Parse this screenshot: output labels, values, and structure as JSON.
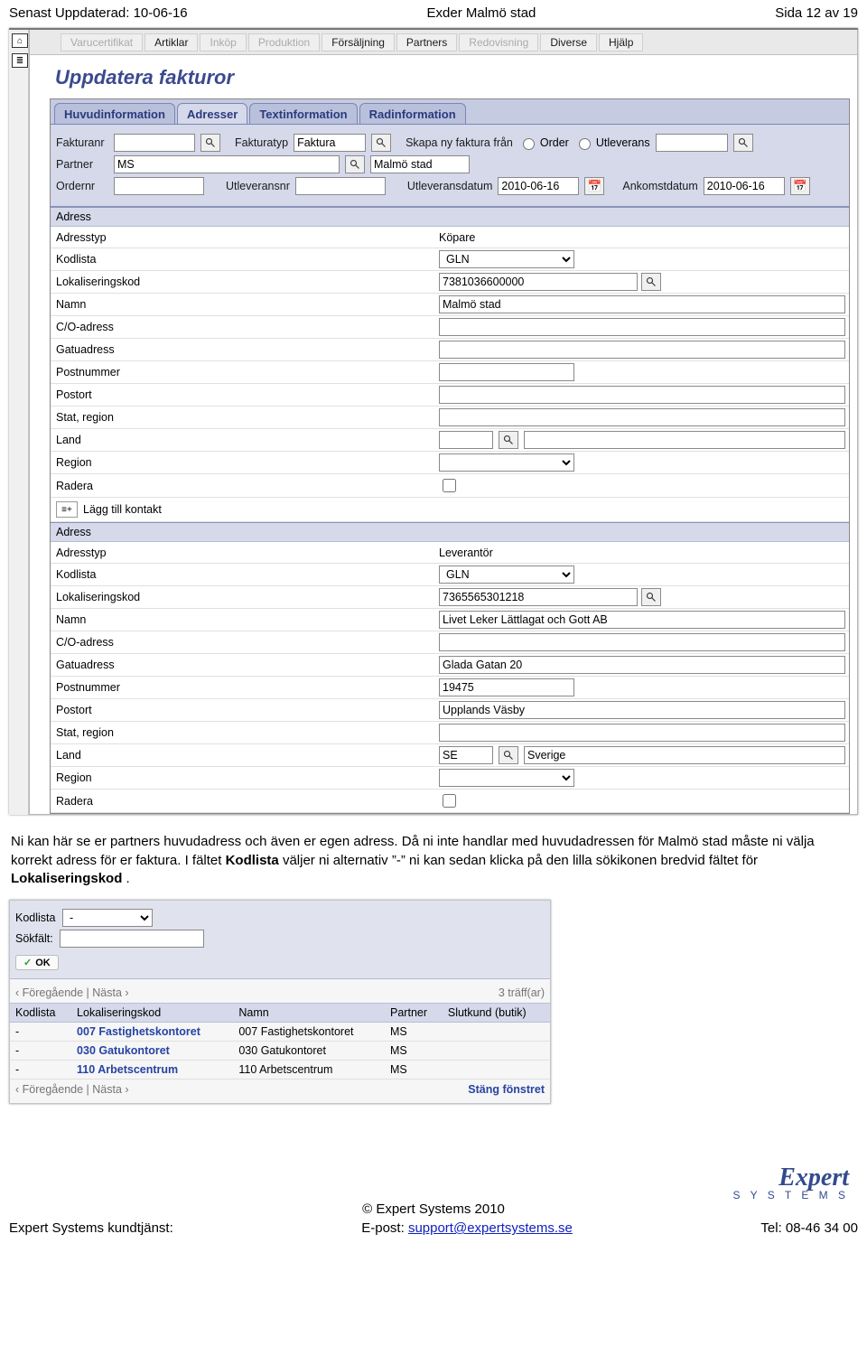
{
  "header": {
    "left": "Senast Uppdaterad: 10-06-16",
    "center": "Exder Malmö stad",
    "right": "Sida 12 av 19"
  },
  "menubar": {
    "items": [
      {
        "label": "Varucertifikat",
        "disabled": true
      },
      {
        "label": "Artiklar",
        "disabled": false
      },
      {
        "label": "Inköp",
        "disabled": true
      },
      {
        "label": "Produktion",
        "disabled": true
      },
      {
        "label": "Försäljning",
        "disabled": false
      },
      {
        "label": "Partners",
        "disabled": false
      },
      {
        "label": "Redovisning",
        "disabled": true
      },
      {
        "label": "Diverse",
        "disabled": false
      },
      {
        "label": "Hjälp",
        "disabled": false
      }
    ]
  },
  "page_title": "Uppdatera fakturor",
  "tabs": {
    "items": [
      {
        "label": "Huvudinformation",
        "active": false
      },
      {
        "label": "Adresser",
        "active": true
      },
      {
        "label": "Textinformation",
        "active": false
      },
      {
        "label": "Radinformation",
        "active": false
      }
    ]
  },
  "top_form": {
    "fakturanr_label": "Fakturanr",
    "fakturanr": "",
    "fakturatyp_label": "Fakturatyp",
    "fakturatyp": "Faktura",
    "skapa_label": "Skapa ny faktura från",
    "order_label": "Order",
    "utleverans_label": "Utleverans",
    "partner_label": "Partner",
    "partner": "MS",
    "partner_name": "Malmö stad",
    "ordernr_label": "Ordernr",
    "ordernr": "",
    "utleveransnr_label": "Utleveransnr",
    "utleveransnr": "",
    "utleveransdatum_label": "Utleveransdatum",
    "utleveransdatum": "2010-06-16",
    "ankomstdatum_label": "Ankomstdatum",
    "ankomstdatum": "2010-06-16"
  },
  "address_section_label": "Adress",
  "address_labels": {
    "adresstyp": "Adresstyp",
    "kodlista": "Kodlista",
    "lokaliseringskod": "Lokaliseringskod",
    "namn": "Namn",
    "co": "C/O-adress",
    "gatu": "Gatuadress",
    "postnr": "Postnummer",
    "postort": "Postort",
    "stat": "Stat, region",
    "land": "Land",
    "region": "Region",
    "radera": "Radera",
    "addcontact": "Lägg till kontakt"
  },
  "addr_buyer": {
    "adresstyp": "Köpare",
    "kodlista": "GLN",
    "lokaliseringskod": "7381036600000",
    "namn": "Malmö stad",
    "co": "",
    "gatu": "",
    "postnr": "",
    "postort": "",
    "stat": "",
    "land_code": "",
    "land_name": "",
    "region": ""
  },
  "addr_supplier": {
    "adresstyp": "Leverantör",
    "kodlista": "GLN",
    "lokaliseringskod": "7365565301218",
    "namn": "Livet Leker Lättlagat och Gott AB",
    "co": "",
    "gatu": "Glada Gatan 20",
    "postnr": "19475",
    "postort": "Upplands Väsby",
    "stat": "",
    "land_code": "SE",
    "land_name": "Sverige",
    "region": ""
  },
  "body_text": {
    "sentences": [
      "Ni kan här se er partners huvudadress och även er egen adress. Då ni inte handlar med huvudadressen för Malmö stad måste ni välja korrekt adress för er faktura. I fältet ",
      "Kodlista",
      " väljer ni alternativ ”-” ni kan sedan klicka på den lilla sökikonen bredvid fältet för ",
      "Lokaliseringskod",
      "."
    ]
  },
  "popup": {
    "kodlista_label": "Kodlista",
    "kodlista": "-",
    "sokfalt_label": "Sökfält:",
    "sokfalt": "",
    "ok": "OK",
    "nav_prev": "‹ Föregående",
    "nav_next": "Nästa ›",
    "hits": "3 träff(ar)",
    "cols": [
      "Kodlista",
      "Lokaliseringskod",
      "Namn",
      "Partner",
      "Slutkund (butik)"
    ],
    "rows": [
      {
        "kod": "-",
        "lok": "007 Fastighetskontoret",
        "namn": "007 Fastighetskontoret",
        "partner": "MS",
        "slut": ""
      },
      {
        "kod": "-",
        "lok": "030 Gatukontoret",
        "namn": "030 Gatukontoret",
        "partner": "MS",
        "slut": ""
      },
      {
        "kod": "-",
        "lok": "110 Arbetscentrum",
        "namn": "110 Arbetscentrum",
        "partner": "MS",
        "slut": ""
      }
    ],
    "close": "Stäng fönstret"
  },
  "footer": {
    "copyright": "© Expert Systems 2010",
    "left": "Expert Systems kundtjänst:",
    "mid_label": "E-post: ",
    "mid_mail": "support@expertsystems.se",
    "right": "Tel: 08-46 34 00",
    "logo1": "Expert",
    "logo2": "S Y S T E M S"
  }
}
